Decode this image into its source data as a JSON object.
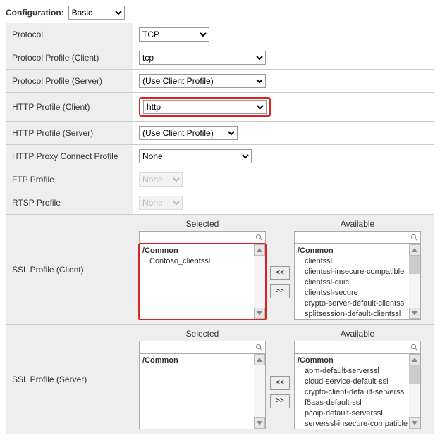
{
  "top": {
    "label": "Configuration:",
    "value": "Basic"
  },
  "rows": {
    "protocol": {
      "label": "Protocol",
      "value": "TCP"
    },
    "ppc": {
      "label": "Protocol Profile (Client)",
      "value": "tcp"
    },
    "pps": {
      "label": "Protocol Profile (Server)",
      "value": "(Use Client Profile)"
    },
    "hpc": {
      "label": "HTTP Profile (Client)",
      "value": "http"
    },
    "hps": {
      "label": "HTTP Profile (Server)",
      "value": "(Use Client Profile)"
    },
    "hproxy": {
      "label": "HTTP Proxy Connect Profile",
      "value": "None"
    },
    "ftp": {
      "label": "FTP Profile",
      "value": "None"
    },
    "rtsp": {
      "label": "RTSP Profile",
      "value": "None"
    },
    "sslc": {
      "label": "SSL Profile (Client)"
    },
    "ssls": {
      "label": "SSL Profile (Server)"
    }
  },
  "dual": {
    "selected_hdr": "Selected",
    "available_hdr": "Available",
    "move_left": "<<",
    "move_right": ">>",
    "folder": "/Common"
  },
  "ssl_client": {
    "selected": [
      "Contoso_clientssl"
    ],
    "available": [
      "clientssl",
      "clientssl-insecure-compatible",
      "clientssl-quic",
      "clientssl-secure",
      "crypto-server-default-clientssl",
      "splitsession-default-clientssl"
    ]
  },
  "ssl_server": {
    "selected": [],
    "available": [
      "apm-default-serverssl",
      "cloud-service-default-ssl",
      "crypto-client-default-serverssl",
      "f5aas-default-ssl",
      "pcoip-default-serverssl",
      "serverssl-insecure-compatible"
    ]
  }
}
